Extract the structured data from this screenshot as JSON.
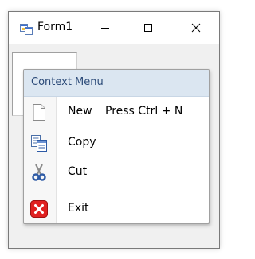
{
  "window": {
    "title": "Form1",
    "icon": "winforms-app-icon"
  },
  "caption_buttons": {
    "minimize": "minimize-icon",
    "maximize": "maximize-icon",
    "close": "close-icon"
  },
  "context_menu": {
    "header": "Context Menu",
    "items": [
      {
        "label": "New",
        "shortcut": "Press Ctrl + N",
        "icon": "new-document-icon"
      },
      {
        "label": "Copy",
        "shortcut": "",
        "icon": "copy-icon"
      },
      {
        "label": "Cut",
        "shortcut": "",
        "icon": "cut-scissors-icon"
      },
      {
        "label": "Exit",
        "shortcut": "",
        "icon": "exit-icon"
      }
    ]
  },
  "colors": {
    "header_bg": "#dbe6f1",
    "header_text": "#2b4a78",
    "exit_red": "#e02020"
  }
}
